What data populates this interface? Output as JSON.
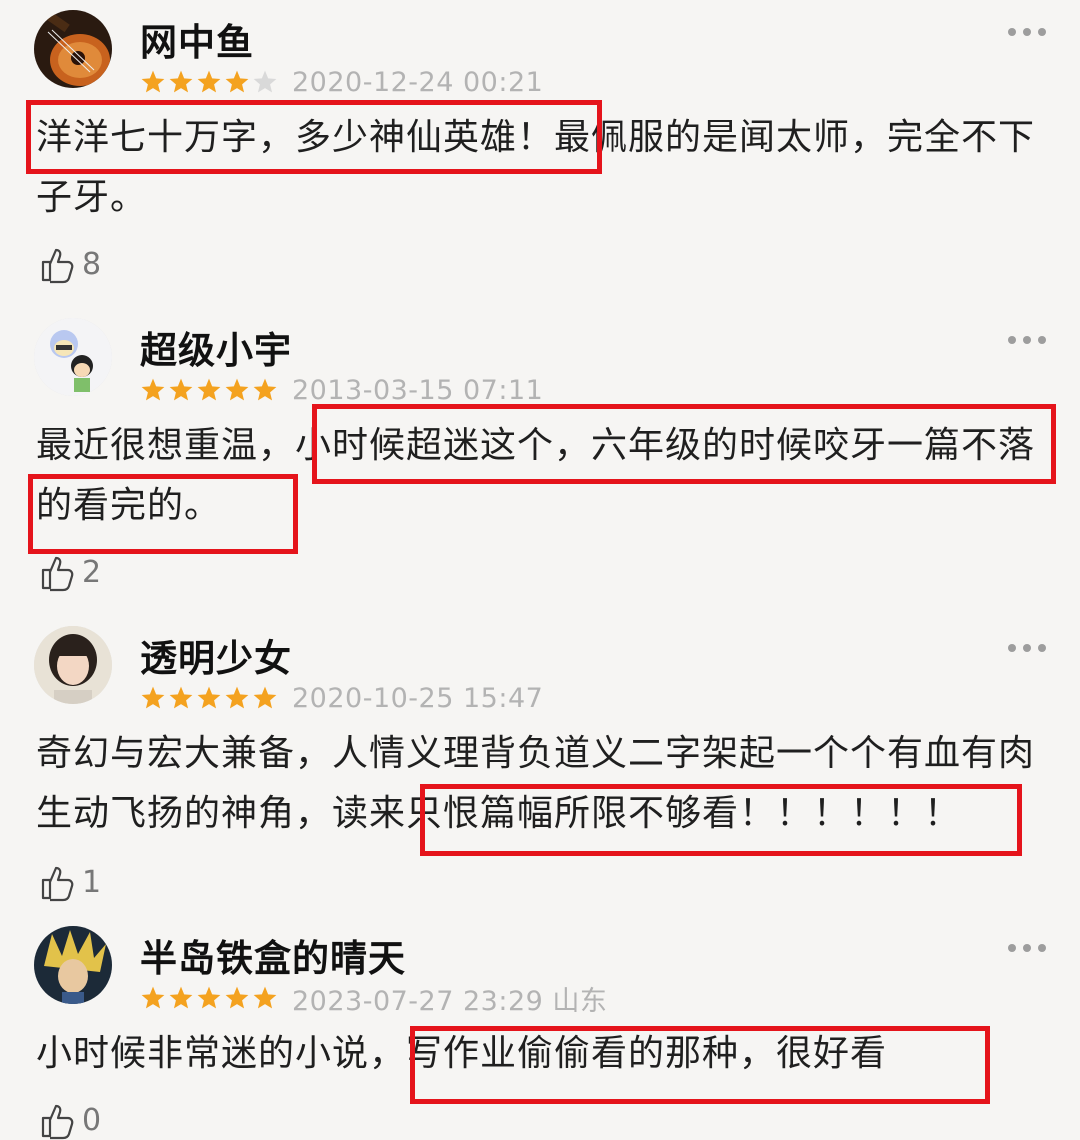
{
  "reviews": [
    {
      "username": "网中鱼",
      "stars": 4,
      "date": "2020-12-24 00:21",
      "content": "洋洋七十万字，多少神仙英雄！最佩服的是闻太师，完全不下子牙。",
      "likes": "8",
      "avatar_icon": "guitar-avatar-icon"
    },
    {
      "username": "超级小宇",
      "stars": 5,
      "date": "2013-03-15 07:11",
      "content": "最近很想重温，小时候超迷这个，六年级的时候咬牙一篇不落的看完的。",
      "likes": "2",
      "avatar_icon": "cartoon-avatar-icon"
    },
    {
      "username": "透明少女",
      "stars": 5,
      "date": "2020-10-25 15:47",
      "content": "奇幻与宏大兼备，人情义理背负道义二字架起一个个有血有肉生动飞扬的神角，读来只恨篇幅所限不够看！！！！！！",
      "likes": "1",
      "avatar_icon": "girl-avatar-icon"
    },
    {
      "username": "半岛铁盒的晴天",
      "stars": 5,
      "date": "2023-07-27 23:29 山东",
      "content": "小时候非常迷的小说，写作业偷偷看的那种，很好看",
      "likes": "0",
      "avatar_icon": "anime-avatar-icon"
    }
  ],
  "colors": {
    "star_filled": "#f4a21f",
    "star_empty": "#d9d9d9",
    "highlight": "#e5141b",
    "background": "#f6f5f3"
  }
}
